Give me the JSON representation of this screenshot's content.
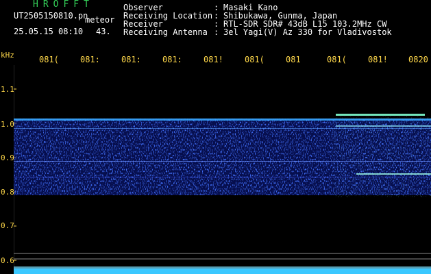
{
  "header": {
    "brand": "HROFFT",
    "filename": "UT2505150810.pn",
    "tag": "meteor",
    "datetime": "25.05.15 08:10",
    "count": "43.",
    "fields": [
      {
        "label": "Observer",
        "value": "Masaki Kano"
      },
      {
        "label": "Receiving Location",
        "value": "Shibukawa, Gunma, Japan"
      },
      {
        "label": "Receiver",
        "value": "RTL-SDR SDR# 43dB L15 103.2MHz CW"
      },
      {
        "label": "Receiving Antenna",
        "value": "3el Yagi(V) Az 330 for Vladivostok"
      }
    ],
    "separator": ":"
  },
  "axis": {
    "unit": "kHz",
    "x_ticks": [
      "081(",
      "081:",
      "081:",
      "081:",
      "081!",
      "081(",
      "081",
      "081(",
      "081!",
      "0820"
    ],
    "y_ticks": [
      "1.1",
      "1.0",
      "0.9",
      "0.8",
      "0.7",
      "0.6"
    ]
  },
  "colors": {
    "background": "#000000",
    "header_green": "#35d35a",
    "tick_yellow": "#ffd84a",
    "signal_blue": "#1f3cff",
    "signal_cyan": "#55f0ff",
    "baseline": "#7ad7ff"
  }
}
